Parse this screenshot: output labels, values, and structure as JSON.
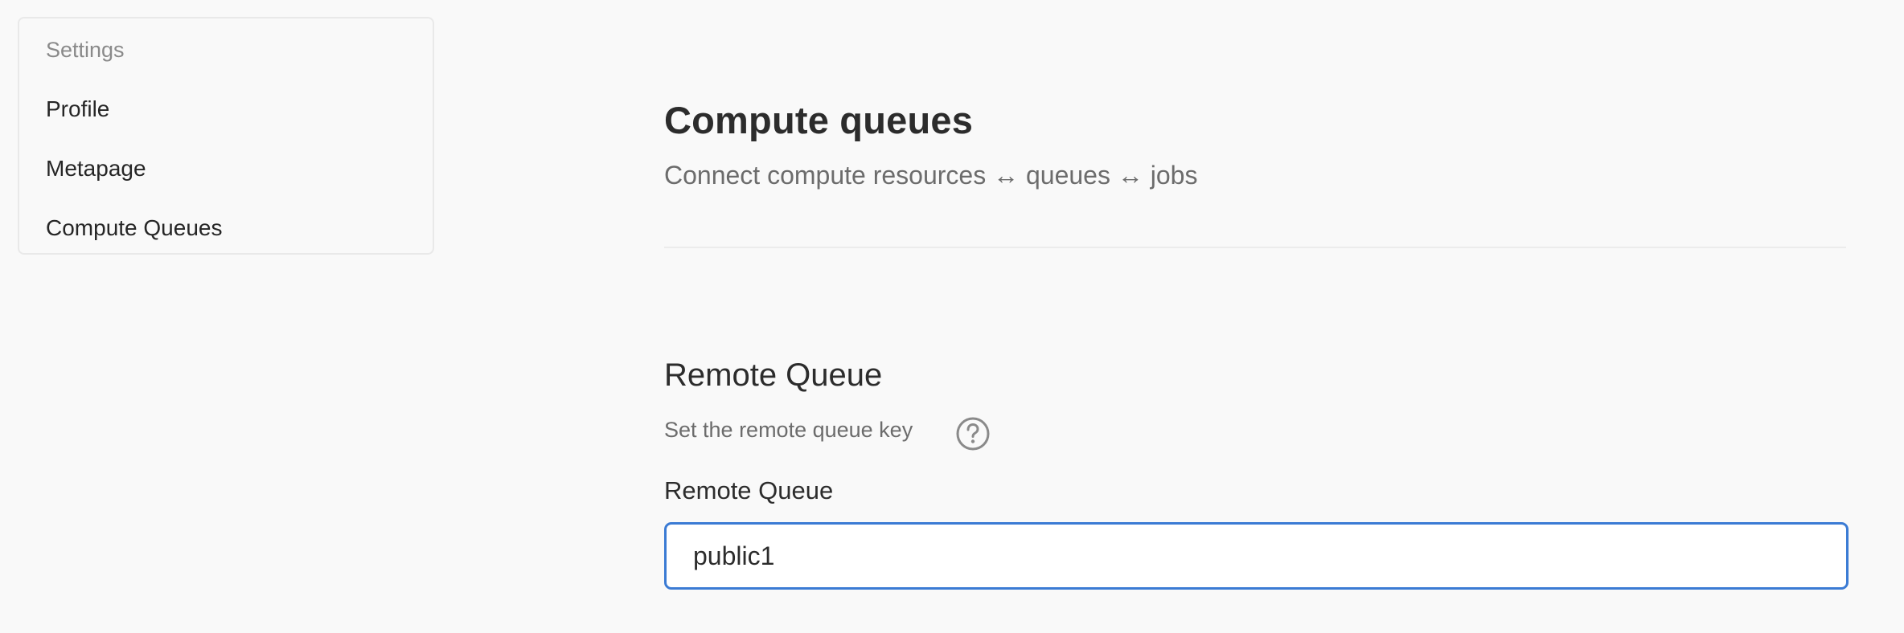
{
  "sidebar": {
    "header": "Settings",
    "items": [
      {
        "label": "Profile"
      },
      {
        "label": "Metapage"
      },
      {
        "label": "Compute Queues"
      }
    ]
  },
  "main": {
    "title": "Compute queues",
    "subtitle": "Connect compute resources ↔ queues ↔ jobs",
    "section": {
      "title": "Remote Queue",
      "description": "Set the remote queue key",
      "help_icon": "question-circle-icon",
      "field_label": "Remote Queue",
      "field_value": "public1",
      "field_placeholder": ""
    }
  },
  "colors": {
    "background": "#f9f9f9",
    "focus_border": "#3b7bd4",
    "muted_text": "#6c6c6c"
  }
}
